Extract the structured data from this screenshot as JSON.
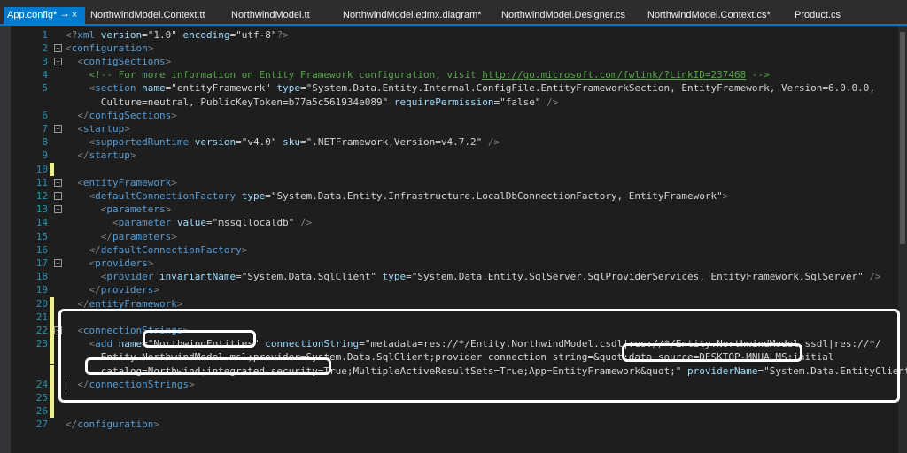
{
  "tabs": [
    {
      "label": "App.config*",
      "pin": "⊸",
      "close": "×"
    },
    {
      "label": "NorthwindModel.Context.tt"
    },
    {
      "label": "NorthwindModel.tt"
    },
    {
      "label": "NorthwindModel.edmx.diagram*"
    },
    {
      "label": "NorthwindModel.Designer.cs"
    },
    {
      "label": "NorthwindModel.Context.cs*"
    },
    {
      "label": "Product.cs"
    }
  ],
  "lines": [
    {
      "n": "1",
      "yellow": false,
      "fold": "",
      "t": [
        [
          "delim",
          "<?"
        ],
        [
          "elem",
          "xml"
        ],
        [
          "t",
          " "
        ],
        [
          "attr",
          "version"
        ],
        [
          "eq",
          "="
        ],
        [
          "val",
          "\"1.0\""
        ],
        [
          "t",
          " "
        ],
        [
          "attr",
          "encoding"
        ],
        [
          "eq",
          "="
        ],
        [
          "val",
          "\"utf-8\""
        ],
        [
          "delim",
          "?>"
        ]
      ]
    },
    {
      "n": "2",
      "yellow": false,
      "fold": "−",
      "t": [
        [
          "delim",
          "<"
        ],
        [
          "elem",
          "configuration"
        ],
        [
          "delim",
          ">"
        ]
      ]
    },
    {
      "n": "3",
      "yellow": false,
      "fold": "−",
      "t": [
        [
          "t",
          "  "
        ],
        [
          "delim",
          "<"
        ],
        [
          "elem",
          "configSections"
        ],
        [
          "delim",
          ">"
        ]
      ]
    },
    {
      "n": "4",
      "yellow": false,
      "fold": "",
      "t": [
        [
          "t",
          "    "
        ],
        [
          "comment",
          "<!-- For more information on Entity Framework configuration, visit "
        ],
        [
          "link",
          "http://go.microsoft.com/fwlink/?LinkID=237468"
        ],
        [
          "comment",
          " -->"
        ]
      ]
    },
    {
      "n": "5",
      "yellow": false,
      "fold": "",
      "t": [
        [
          "t",
          "    "
        ],
        [
          "delim",
          "<"
        ],
        [
          "elem",
          "section"
        ],
        [
          "t",
          " "
        ],
        [
          "attr",
          "name"
        ],
        [
          "eq",
          "="
        ],
        [
          "val",
          "\"entityFramework\""
        ],
        [
          "t",
          " "
        ],
        [
          "attr",
          "type"
        ],
        [
          "eq",
          "="
        ],
        [
          "val",
          "\"System.Data.Entity.Internal.ConfigFile.EntityFrameworkSection, EntityFramework, Version=6.0.0.0,"
        ]
      ]
    },
    {
      "n": "",
      "yellow": false,
      "fold": "",
      "t": [
        [
          "val",
          "      Culture=neutral, PublicKeyToken=b77a5c561934e089\""
        ],
        [
          "t",
          " "
        ],
        [
          "attr",
          "requirePermission"
        ],
        [
          "eq",
          "="
        ],
        [
          "val",
          "\"false\""
        ],
        [
          "t",
          " "
        ],
        [
          "delim",
          "/>"
        ]
      ]
    },
    {
      "n": "6",
      "yellow": false,
      "fold": "",
      "t": [
        [
          "t",
          "  "
        ],
        [
          "delim",
          "</"
        ],
        [
          "elem",
          "configSections"
        ],
        [
          "delim",
          ">"
        ]
      ]
    },
    {
      "n": "7",
      "yellow": false,
      "fold": "−",
      "t": [
        [
          "t",
          "  "
        ],
        [
          "delim",
          "<"
        ],
        [
          "elem",
          "startup"
        ],
        [
          "delim",
          ">"
        ]
      ]
    },
    {
      "n": "8",
      "yellow": false,
      "fold": "",
      "t": [
        [
          "t",
          "    "
        ],
        [
          "delim",
          "<"
        ],
        [
          "elem",
          "supportedRuntime"
        ],
        [
          "t",
          " "
        ],
        [
          "attr",
          "version"
        ],
        [
          "eq",
          "="
        ],
        [
          "val",
          "\"v4.0\""
        ],
        [
          "t",
          " "
        ],
        [
          "attr",
          "sku"
        ],
        [
          "eq",
          "="
        ],
        [
          "val",
          "\".NETFramework,Version=v4.7.2\""
        ],
        [
          "t",
          " "
        ],
        [
          "delim",
          "/>"
        ]
      ]
    },
    {
      "n": "9",
      "yellow": false,
      "fold": "",
      "t": [
        [
          "t",
          "  "
        ],
        [
          "delim",
          "</"
        ],
        [
          "elem",
          "startup"
        ],
        [
          "delim",
          ">"
        ]
      ]
    },
    {
      "n": "10",
      "yellow": true,
      "fold": "",
      "t": []
    },
    {
      "n": "11",
      "yellow": false,
      "fold": "−",
      "t": [
        [
          "t",
          "  "
        ],
        [
          "delim",
          "<"
        ],
        [
          "elem",
          "entityFramework"
        ],
        [
          "delim",
          ">"
        ]
      ]
    },
    {
      "n": "12",
      "yellow": false,
      "fold": "−",
      "t": [
        [
          "t",
          "    "
        ],
        [
          "delim",
          "<"
        ],
        [
          "elem",
          "defaultConnectionFactory"
        ],
        [
          "t",
          " "
        ],
        [
          "attr",
          "type"
        ],
        [
          "eq",
          "="
        ],
        [
          "val",
          "\"System.Data.Entity.Infrastructure.LocalDbConnectionFactory, EntityFramework\""
        ],
        [
          "delim",
          ">"
        ]
      ]
    },
    {
      "n": "13",
      "yellow": false,
      "fold": "−",
      "t": [
        [
          "t",
          "      "
        ],
        [
          "delim",
          "<"
        ],
        [
          "elem",
          "parameters"
        ],
        [
          "delim",
          ">"
        ]
      ]
    },
    {
      "n": "14",
      "yellow": false,
      "fold": "",
      "t": [
        [
          "t",
          "        "
        ],
        [
          "delim",
          "<"
        ],
        [
          "elem",
          "parameter"
        ],
        [
          "t",
          " "
        ],
        [
          "attr",
          "value"
        ],
        [
          "eq",
          "="
        ],
        [
          "val",
          "\"mssqllocaldb\""
        ],
        [
          "t",
          " "
        ],
        [
          "delim",
          "/>"
        ]
      ]
    },
    {
      "n": "15",
      "yellow": false,
      "fold": "",
      "t": [
        [
          "t",
          "      "
        ],
        [
          "delim",
          "</"
        ],
        [
          "elem",
          "parameters"
        ],
        [
          "delim",
          ">"
        ]
      ]
    },
    {
      "n": "16",
      "yellow": false,
      "fold": "",
      "t": [
        [
          "t",
          "    "
        ],
        [
          "delim",
          "</"
        ],
        [
          "elem",
          "defaultConnectionFactory"
        ],
        [
          "delim",
          ">"
        ]
      ]
    },
    {
      "n": "17",
      "yellow": false,
      "fold": "−",
      "t": [
        [
          "t",
          "    "
        ],
        [
          "delim",
          "<"
        ],
        [
          "elem",
          "providers"
        ],
        [
          "delim",
          ">"
        ]
      ]
    },
    {
      "n": "18",
      "yellow": false,
      "fold": "",
      "t": [
        [
          "t",
          "      "
        ],
        [
          "delim",
          "<"
        ],
        [
          "elem",
          "provider"
        ],
        [
          "t",
          " "
        ],
        [
          "attr",
          "invariantName"
        ],
        [
          "eq",
          "="
        ],
        [
          "val",
          "\"System.Data.SqlClient\""
        ],
        [
          "t",
          " "
        ],
        [
          "attr",
          "type"
        ],
        [
          "eq",
          "="
        ],
        [
          "val",
          "\"System.Data.Entity.SqlServer.SqlProviderServices, EntityFramework.SqlServer\""
        ],
        [
          "t",
          " "
        ],
        [
          "delim",
          "/>"
        ]
      ]
    },
    {
      "n": "19",
      "yellow": false,
      "fold": "",
      "t": [
        [
          "t",
          "    "
        ],
        [
          "delim",
          "</"
        ],
        [
          "elem",
          "providers"
        ],
        [
          "delim",
          ">"
        ]
      ]
    },
    {
      "n": "20",
      "yellow": true,
      "fold": "",
      "t": [
        [
          "t",
          "  "
        ],
        [
          "delim",
          "</"
        ],
        [
          "elem",
          "entityFramework"
        ],
        [
          "delim",
          ">"
        ]
      ]
    },
    {
      "n": "21",
      "yellow": true,
      "fold": "",
      "t": []
    },
    {
      "n": "22",
      "yellow": true,
      "fold": "−",
      "t": [
        [
          "t",
          "  "
        ],
        [
          "delim",
          "<"
        ],
        [
          "elem",
          "connectionStrings"
        ],
        [
          "delim",
          ">"
        ]
      ]
    },
    {
      "n": "23",
      "yellow": true,
      "fold": "",
      "t": [
        [
          "t",
          "    "
        ],
        [
          "delim",
          "<"
        ],
        [
          "elem",
          "add"
        ],
        [
          "t",
          " "
        ],
        [
          "attr",
          "name"
        ],
        [
          "eq",
          "="
        ],
        [
          "val",
          "\"NorthwindEntities\""
        ],
        [
          "t",
          " "
        ],
        [
          "attr",
          "connectionString"
        ],
        [
          "eq",
          "="
        ],
        [
          "val",
          "\"metadata=res://*/Entity.NorthwindModel.csdl|res://*/Entity.NorthwindModel.ssdl|res://*/"
        ]
      ]
    },
    {
      "n": "",
      "yellow": true,
      "fold": "",
      "t": [
        [
          "val",
          "      Entity.NorthwindModel.msl;provider=System.Data.SqlClient;provider connection string=&quot;data source=DESKTOP-MNUALMS;initial"
        ]
      ]
    },
    {
      "n": "",
      "yellow": true,
      "fold": "",
      "t": [
        [
          "val",
          "      catalog=Northwind;integrated security=True;MultipleActiveResultSets=True;App=EntityFramework&quot;\""
        ],
        [
          "t",
          " "
        ],
        [
          "attr",
          "providerName"
        ],
        [
          "eq",
          "="
        ],
        [
          "val",
          "\"System.Data.EntityClient\""
        ],
        [
          "t",
          " "
        ],
        [
          "delim",
          "/>"
        ]
      ]
    },
    {
      "n": "24",
      "yellow": true,
      "fold": "",
      "t": [
        [
          "t",
          "  "
        ],
        [
          "delim",
          "</"
        ],
        [
          "elem",
          "connectionStrings"
        ],
        [
          "delim",
          ">"
        ]
      ]
    },
    {
      "n": "25",
      "yellow": true,
      "fold": "",
      "t": []
    },
    {
      "n": "26",
      "yellow": true,
      "fold": "",
      "t": []
    },
    {
      "n": "27",
      "yellow": false,
      "fold": "",
      "t": [
        [
          "delim",
          "</"
        ],
        [
          "elem",
          "configuration"
        ],
        [
          "delim",
          ">"
        ]
      ]
    }
  ]
}
